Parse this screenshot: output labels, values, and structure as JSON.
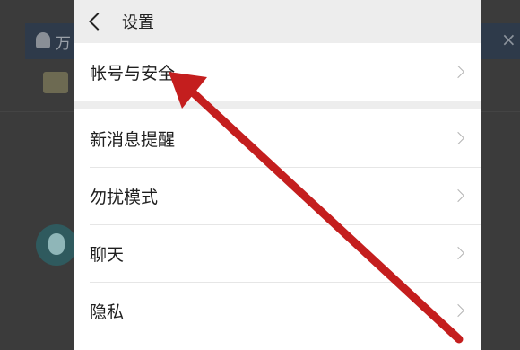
{
  "header": {
    "back_icon": "chevron-left-icon",
    "title": "设置"
  },
  "settings": {
    "account_security": "帐号与安全",
    "items": [
      {
        "label": "新消息提醒"
      },
      {
        "label": "勿扰模式"
      },
      {
        "label": "聊天"
      },
      {
        "label": "隐私"
      }
    ]
  },
  "background": {
    "banner_text": "万",
    "close_glyph": "×"
  },
  "annotation": {
    "arrow_color": "#c41e1e"
  }
}
